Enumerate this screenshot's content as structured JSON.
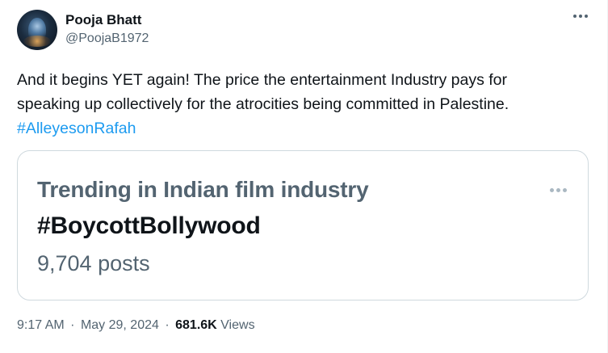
{
  "author": {
    "name": "Pooja Bhatt",
    "handle": "@PoojaB1972"
  },
  "tweet": {
    "text_line1": "And it begins YET again! The price the entertainment Industry pays for",
    "text_line2": "speaking up collectively for the atrocities being committed in Palestine.",
    "hashtag": "#AlleyesonRafah"
  },
  "trend_card": {
    "topic": "Trending in Indian film industry",
    "hashtag": "#BoycottBollywood",
    "posts": "9,704 posts"
  },
  "meta": {
    "time": "9:17 AM",
    "date": "May 29, 2024",
    "separator": "·",
    "views_count": "681.6K",
    "views_label": "Views"
  },
  "icons": {
    "more": "more-horizontal-icon"
  },
  "colors": {
    "text": "#0f1419",
    "secondary": "#536471",
    "link": "#1d9bf0",
    "border": "#cfd9de"
  }
}
